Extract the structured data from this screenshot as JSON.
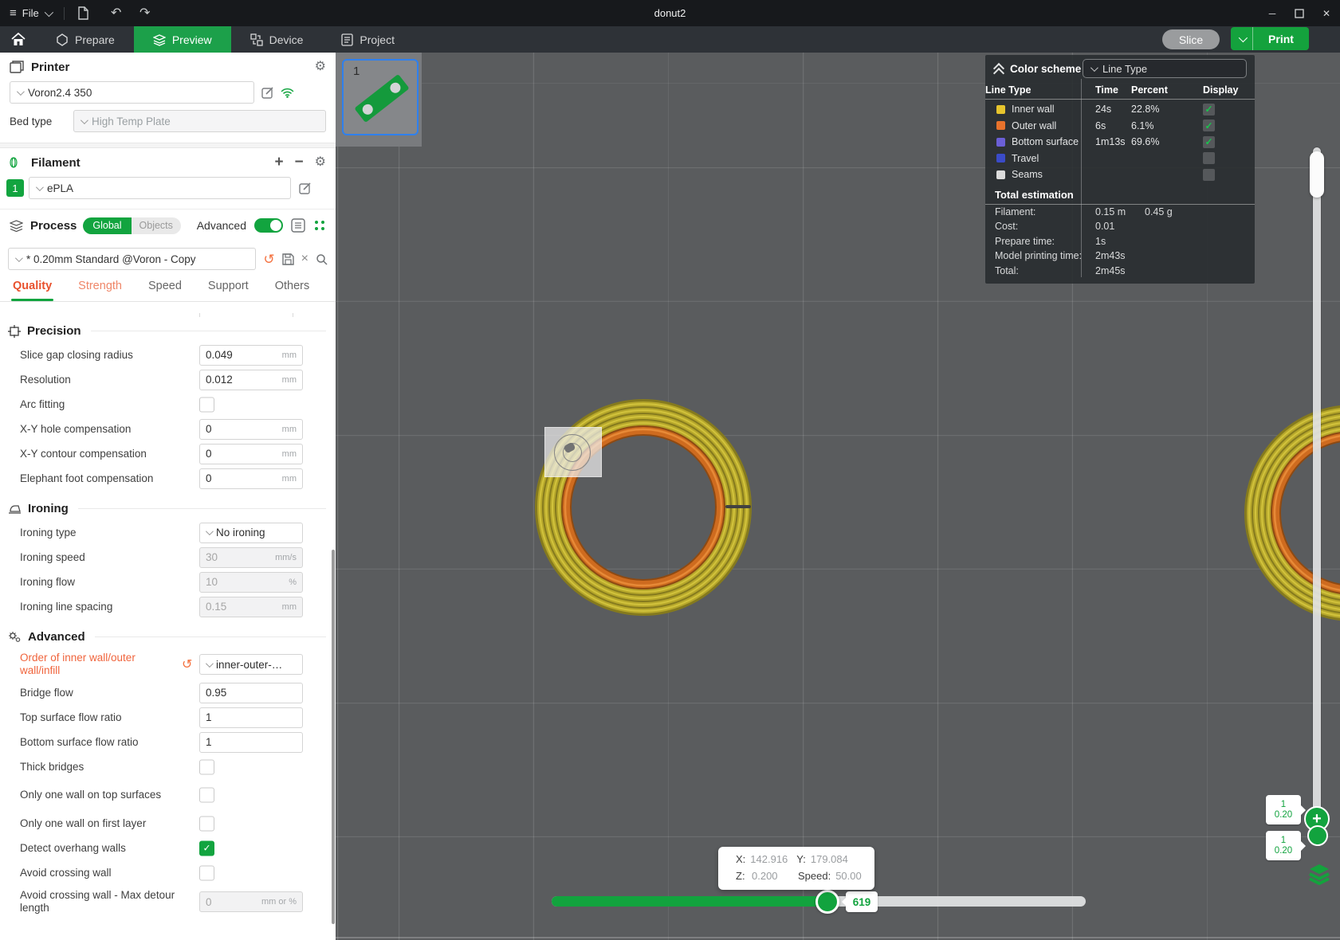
{
  "window": {
    "title": "donut2",
    "menu_file": "File"
  },
  "nav": {
    "tabs": [
      {
        "label": "Prepare"
      },
      {
        "label": "Preview"
      },
      {
        "label": "Device"
      },
      {
        "label": "Project"
      }
    ],
    "slice_label": "Slice",
    "print_label": "Print"
  },
  "printer": {
    "section_title": "Printer",
    "name": "Voron2.4 350",
    "bed_type_label": "Bed type",
    "bed_type": "High Temp Plate"
  },
  "filament": {
    "section_title": "Filament",
    "slot": "1",
    "name": "ePLA"
  },
  "process": {
    "section_title": "Process",
    "global_label": "Global",
    "objects_label": "Objects",
    "advanced_label": "Advanced",
    "preset": "* 0.20mm Standard @Voron - Copy",
    "tabs": [
      "Quality",
      "Strength",
      "Speed",
      "Support",
      "Others"
    ]
  },
  "settings": {
    "precision": {
      "title": "Precision",
      "rows": [
        {
          "label": "Slice gap closing radius",
          "value": "0.049",
          "unit": "mm"
        },
        {
          "label": "Resolution",
          "value": "0.012",
          "unit": "mm"
        },
        {
          "label": "Arc fitting",
          "checked": false
        },
        {
          "label": "X-Y hole compensation",
          "value": "0",
          "unit": "mm"
        },
        {
          "label": "X-Y contour compensation",
          "value": "0",
          "unit": "mm"
        },
        {
          "label": "Elephant foot compensation",
          "value": "0",
          "unit": "mm"
        }
      ]
    },
    "ironing": {
      "title": "Ironing",
      "rows": [
        {
          "label": "Ironing type",
          "value": "No ironing"
        },
        {
          "label": "Ironing speed",
          "value": "30",
          "unit": "mm/s"
        },
        {
          "label": "Ironing flow",
          "value": "10",
          "unit": "%"
        },
        {
          "label": "Ironing line spacing",
          "value": "0.15",
          "unit": "mm"
        }
      ]
    },
    "advanced": {
      "title": "Advanced",
      "rows": [
        {
          "label": "Order of inner wall/outer wall/infill",
          "value": "inner-outer-…",
          "modified": true
        },
        {
          "label": "Bridge flow",
          "value": "0.95"
        },
        {
          "label": "Top surface flow ratio",
          "value": "1"
        },
        {
          "label": "Bottom surface flow ratio",
          "value": "1"
        },
        {
          "label": "Thick bridges",
          "checked": false
        },
        {
          "label": "Only one wall on top surfaces",
          "checked": false
        },
        {
          "label": "Only one wall on first layer",
          "checked": false
        },
        {
          "label": "Detect overhang walls",
          "checked": true
        },
        {
          "label": "Avoid crossing wall",
          "checked": false
        },
        {
          "label": "Avoid crossing wall - Max detour length",
          "value": "0",
          "unit": "mm or %"
        }
      ]
    }
  },
  "legend": {
    "title": "Color scheme",
    "view_mode": "Line Type",
    "columns": [
      "Line Type",
      "Time",
      "Percent",
      "Display"
    ],
    "rows": [
      {
        "label": "Inner wall",
        "color": "#E6C42D",
        "time": "24s",
        "percent": "22.8%",
        "checked": true
      },
      {
        "label": "Outer wall",
        "color": "#E8722C",
        "time": "6s",
        "percent": "6.1%",
        "checked": true
      },
      {
        "label": "Bottom surface",
        "color": "#6B5FD6",
        "time": "1m13s",
        "percent": "69.6%",
        "checked": true
      },
      {
        "label": "Travel",
        "color": "#3A4BC8",
        "time": "",
        "percent": "",
        "checked": false
      },
      {
        "label": "Seams",
        "color": "#DCDCDC",
        "time": "",
        "percent": "",
        "checked": false
      }
    ],
    "estimation": {
      "title": "Total estimation",
      "rows": [
        {
          "label": "Filament:",
          "value": "0.15 m",
          "value2": "0.45 g"
        },
        {
          "label": "Cost:",
          "value": "0.01"
        },
        {
          "label": "Prepare time:",
          "value": "1s"
        },
        {
          "label": "Model printing time:",
          "value": "2m43s"
        },
        {
          "label": "Total:",
          "value": "2m45s"
        }
      ]
    }
  },
  "viewport": {
    "plate_number": "1",
    "move_slider_value": "619",
    "tooltip": {
      "x_label": "X:",
      "x": "142.916",
      "y_label": "Y:",
      "y": "179.084",
      "z_label": "Z:",
      "z": "0.200",
      "speed_label": "Speed:",
      "speed": "50.00"
    },
    "layer_badges": [
      {
        "layer": "1",
        "height": "0.20"
      },
      {
        "layer": "1",
        "height": "0.20"
      }
    ]
  }
}
